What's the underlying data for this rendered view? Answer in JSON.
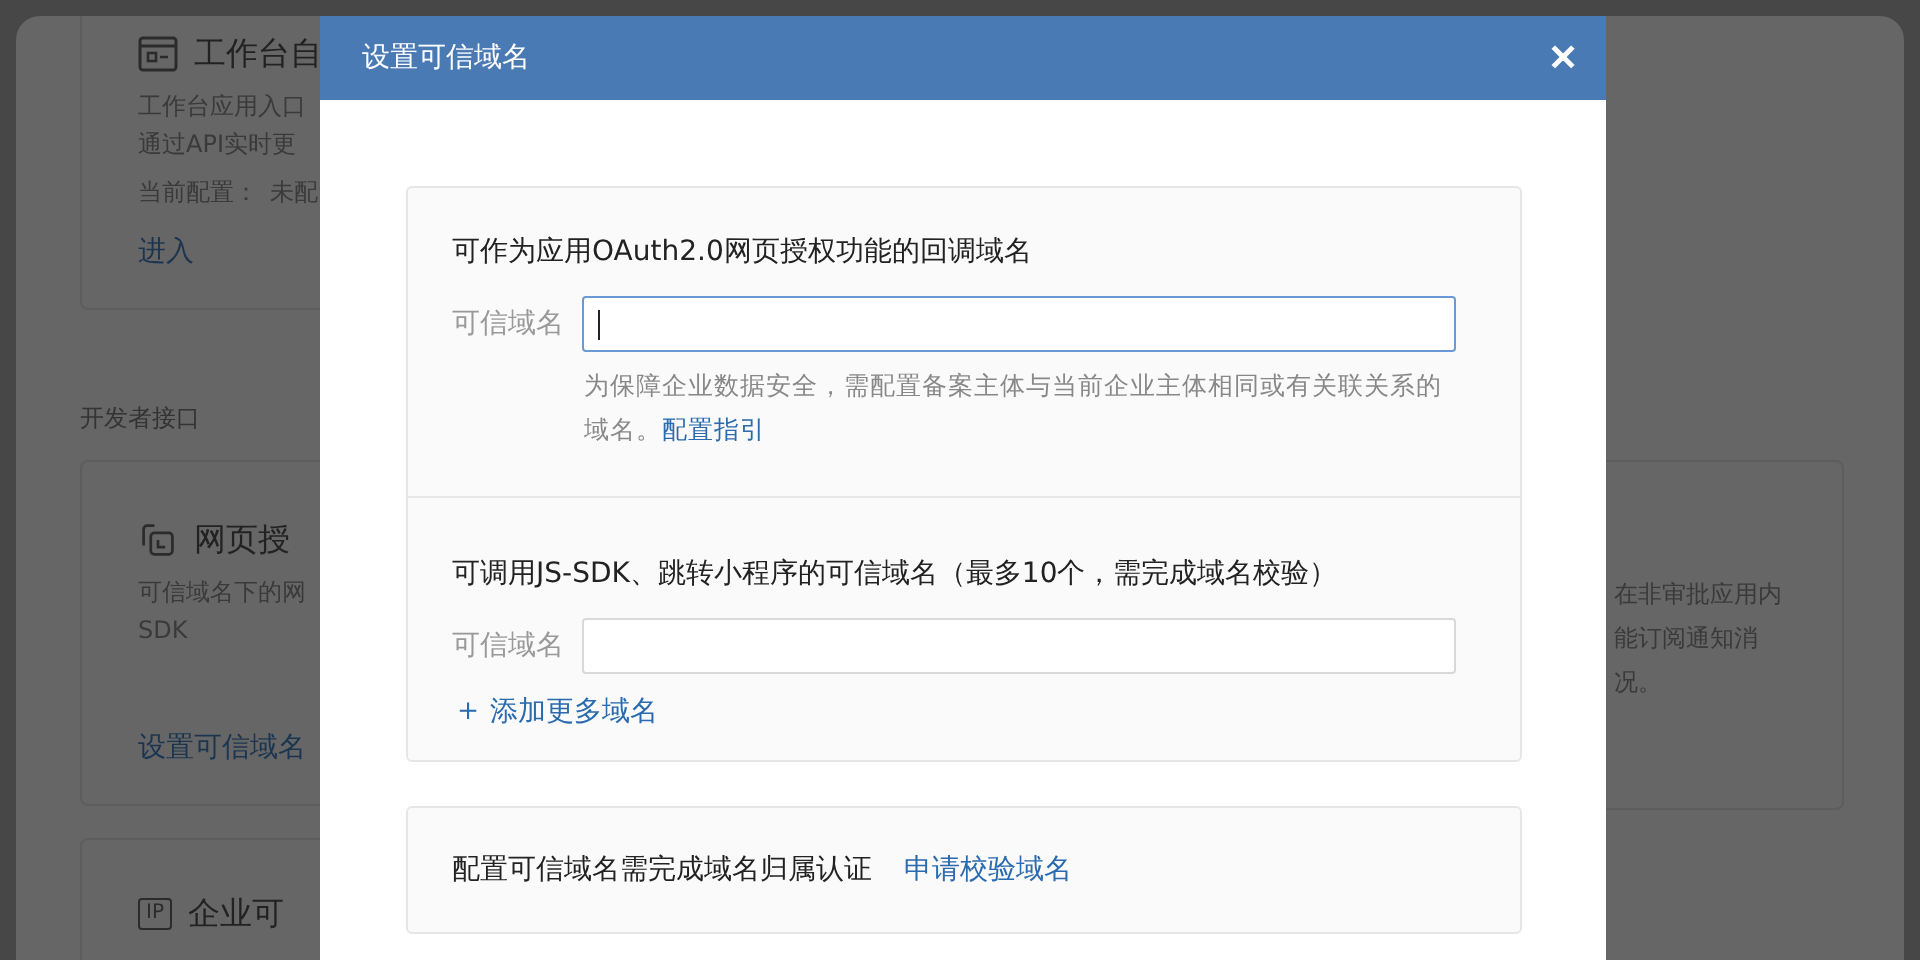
{
  "background": {
    "top_card": {
      "kind": "window",
      "title": "工作台自",
      "lines": [
        "工作台应用入口",
        "通过API实时更"
      ],
      "config_label": "当前配置：",
      "config_value": "未配",
      "link": "进入"
    },
    "section_label": "开发者接口",
    "cards": [
      {
        "kind": "link",
        "title": "网页授",
        "lines": [
          "可信域名下的网",
          "SDK"
        ],
        "link": "设置可信域名"
      },
      {
        "kind": "badge",
        "icon_text": "IP",
        "title": "企业可"
      }
    ],
    "right_card": {
      "lines": [
        "在非审批应用内",
        "能订阅通知消",
        "况。"
      ]
    }
  },
  "dialog": {
    "title": "设置可信域名",
    "close": "✕",
    "sections": [
      {
        "heading": "可作为应用OAuth2.0网页授权功能的回调域名",
        "field_label": "可信域名",
        "focused": true,
        "help": "为保障企业数据安全，需配置备案主体与当前企业主体相同或有关联关系的域名。",
        "help_link": "配置指引"
      },
      {
        "heading": "可调用JS-SDK、跳转小程序的可信域名（最多10个，需完成域名校验）",
        "field_label": "可信域名",
        "focused": false,
        "add_icon": "＋",
        "add_link": "添加更多域名"
      }
    ],
    "verify": {
      "text": "配置可信域名需完成域名归属认证",
      "link": "申请校验域名"
    }
  }
}
